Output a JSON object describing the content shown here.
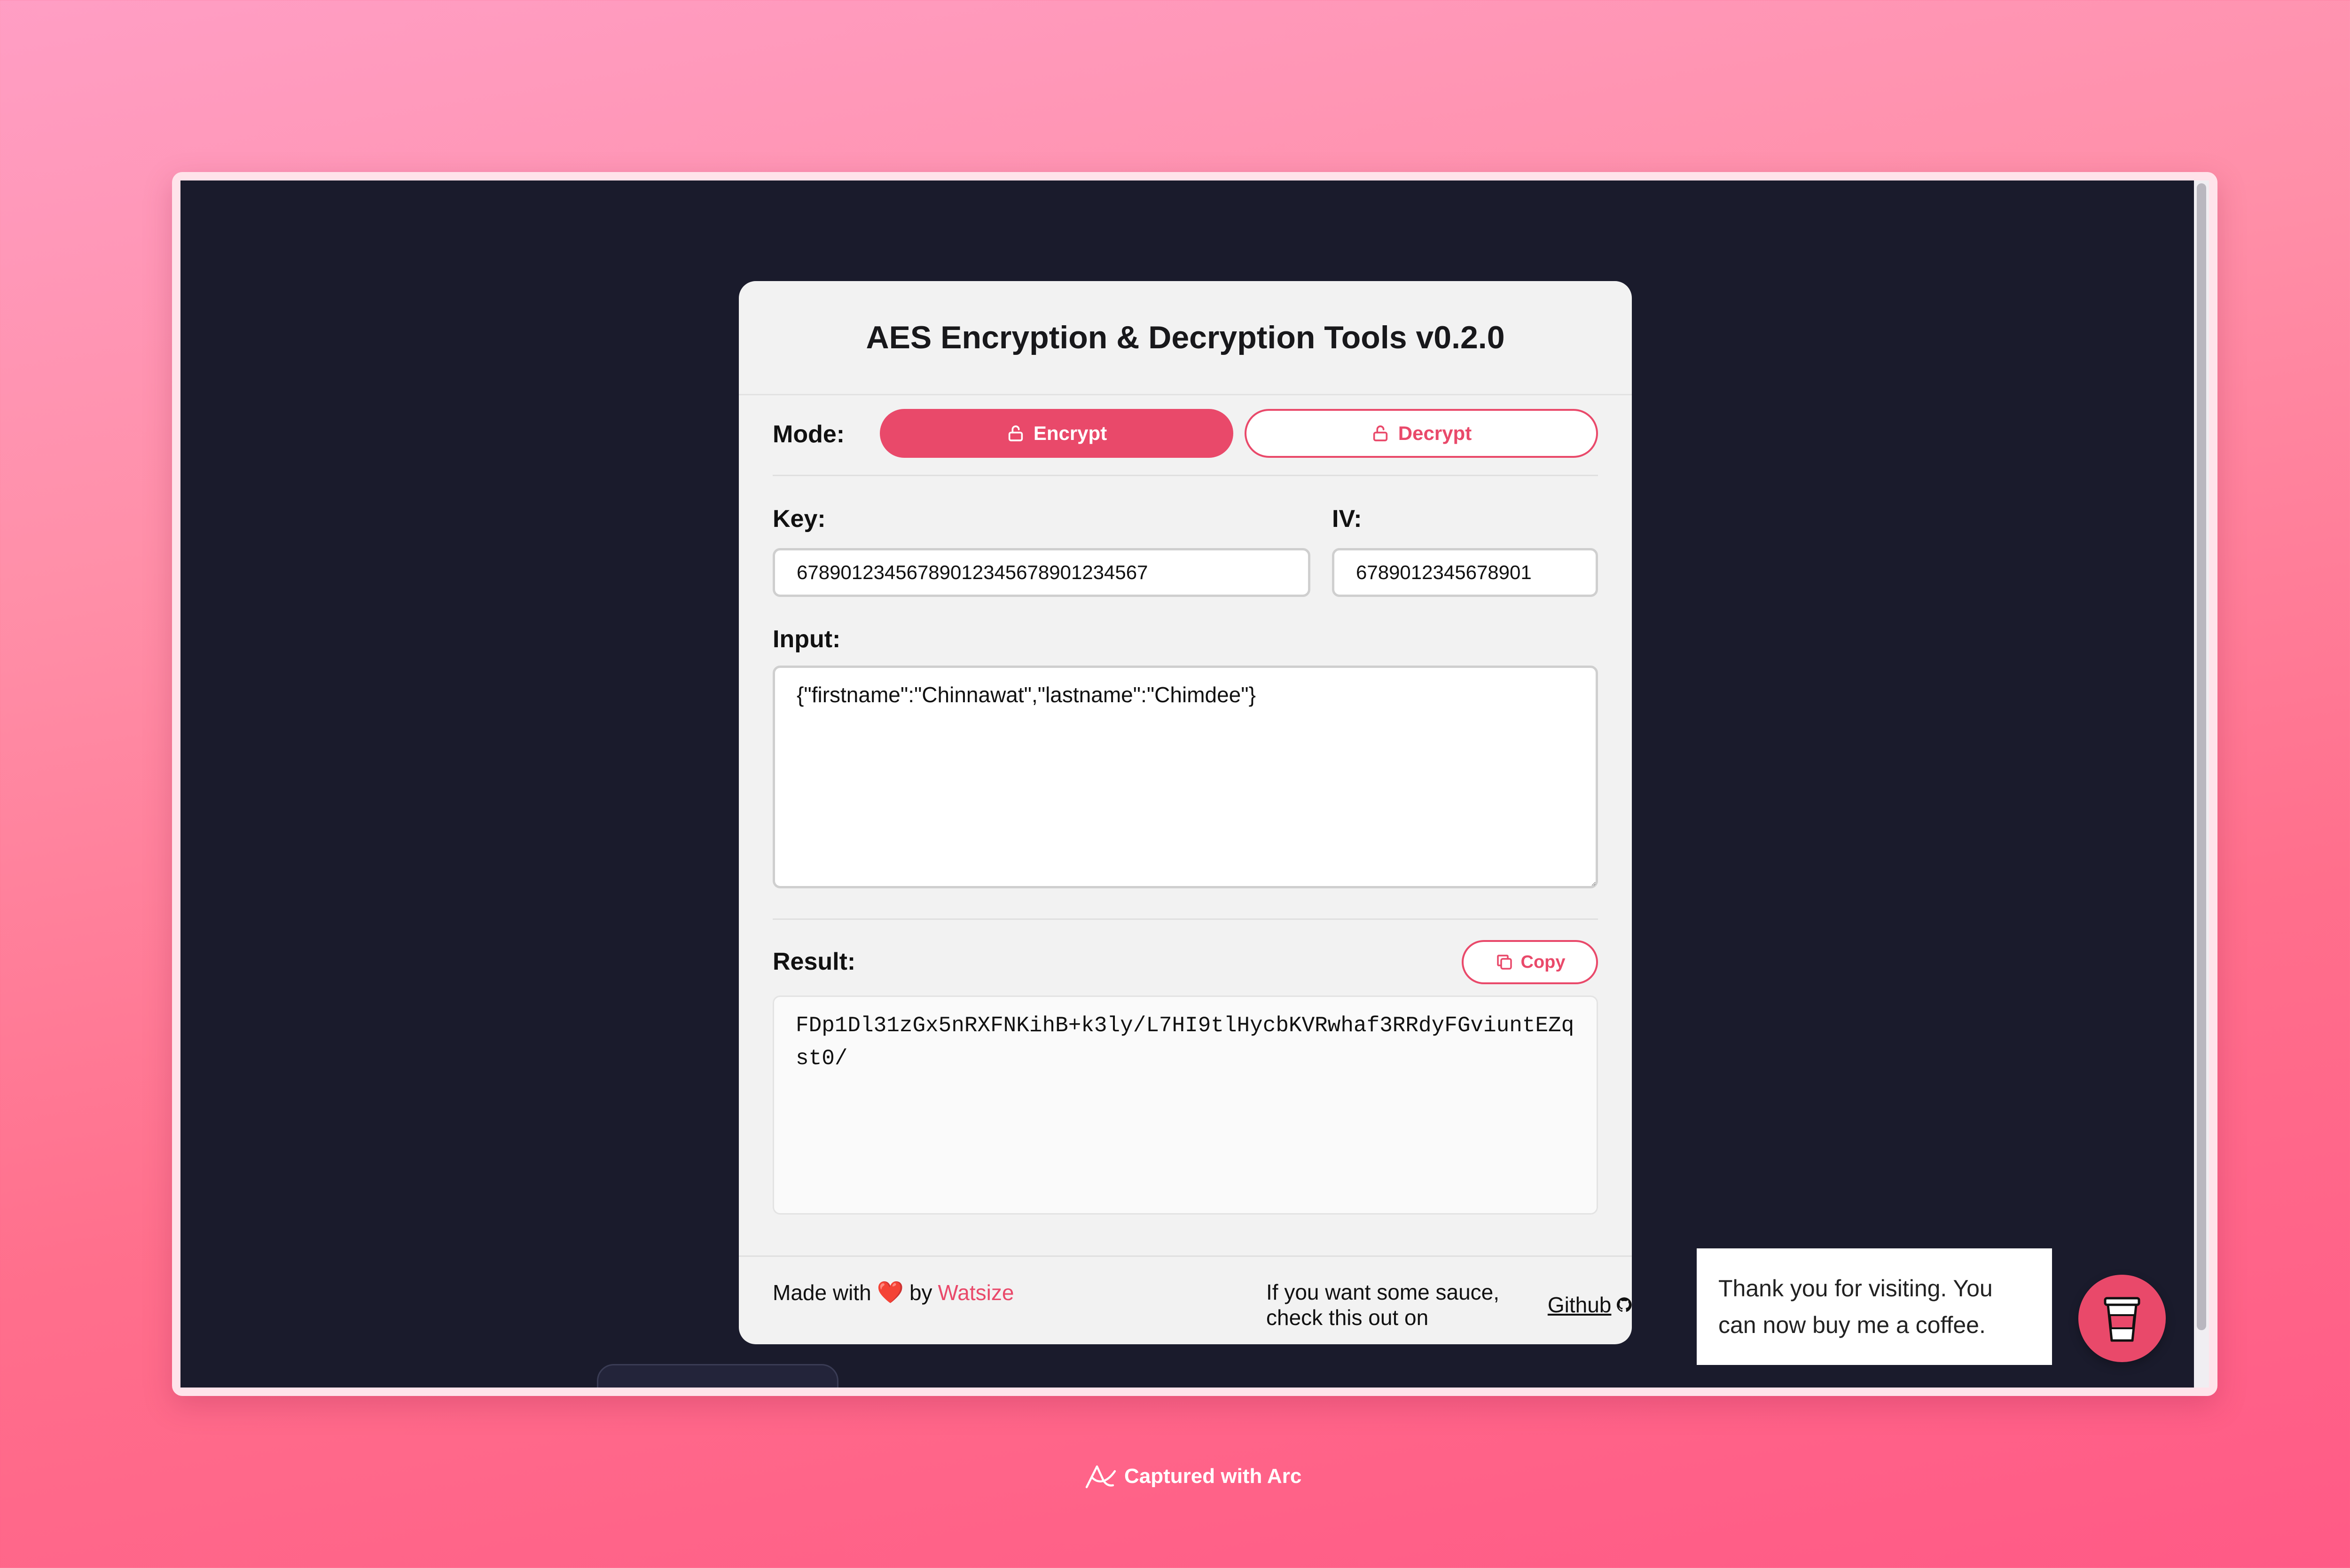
{
  "app": {
    "title": "AES Encryption & Decryption Tools v0.2.0"
  },
  "mode": {
    "label": "Mode:",
    "encrypt_label": "Encrypt",
    "decrypt_label": "Decrypt",
    "selected": "Encrypt"
  },
  "key": {
    "label": "Key:",
    "value": "67890123456789012345678901234567"
  },
  "iv": {
    "label": "IV:",
    "value": "6789012345678901"
  },
  "input": {
    "label": "Input:",
    "value": "{\"firstname\":\"Chinnawat\",\"lastname\":\"Chimdee\"}"
  },
  "result": {
    "label": "Result:",
    "copy_label": "Copy",
    "value": "FDp1Dl31zGx5nRXFNKihB+k3ly/L7HI9tlHycbKVRwhaf3RRdyFGviuntEZqst0/"
  },
  "footer": {
    "made_with": "Made with",
    "heart": "❤️",
    "by": "by",
    "author": "Watsize",
    "sauce_text": "If you want some sauce, check this out on",
    "github": "Github"
  },
  "toast": {
    "message": "Thank you for visiting. You can now buy me a coffee."
  },
  "caption": {
    "text": "Captured with Arc"
  },
  "colors": {
    "accent": "#e9496a",
    "viewport_bg": "#1a1b2c",
    "card_bg": "#f2f2f2"
  }
}
